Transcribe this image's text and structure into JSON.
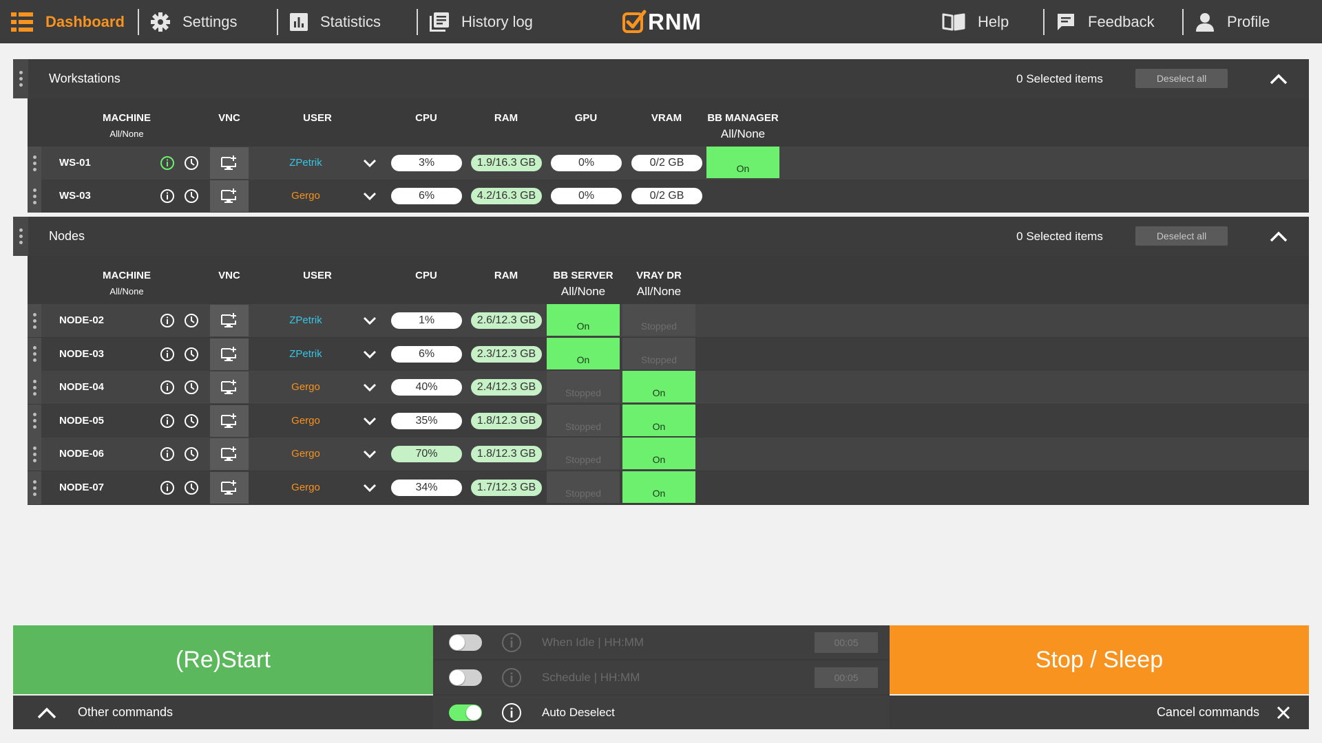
{
  "nav": {
    "dashboard": "Dashboard",
    "settings": "Settings",
    "statistics": "Statistics",
    "history": "History log",
    "logo": "RNM",
    "help": "Help",
    "feedback": "Feedback",
    "profile": "Profile"
  },
  "colors": {
    "accent": "#f7931e",
    "on_status": "#6df06d",
    "restart": "#5cb85c",
    "user_cyan": "#34c6e4",
    "user_orange": "#f7931e"
  },
  "workstations": {
    "title": "Workstations",
    "selected": "0 Selected items",
    "deselect": "Deselect all",
    "headers": {
      "machine": "MACHINE",
      "machine_sub": "All/None",
      "vnc": "VNC",
      "user": "USER",
      "cpu": "CPU",
      "ram": "RAM",
      "gpu": "GPU",
      "vram": "VRAM",
      "bb_manager": "BB MANAGER",
      "bb_manager_sub": "All/None"
    },
    "rows": [
      {
        "name": "WS-01",
        "user": "ZPetrik",
        "cpu": "3%",
        "ram": "1.9/16.3 GB",
        "gpu": "0%",
        "vram": "0/2 GB",
        "bb_manager": "On"
      },
      {
        "name": "WS-03",
        "user": "Gergo",
        "cpu": "6%",
        "ram": "4.2/16.3 GB",
        "gpu": "0%",
        "vram": "0/2 GB",
        "bb_manager": ""
      }
    ]
  },
  "nodes": {
    "title": "Nodes",
    "selected": "0 Selected items",
    "deselect": "Deselect all",
    "headers": {
      "machine": "MACHINE",
      "machine_sub": "All/None",
      "vnc": "VNC",
      "user": "USER",
      "cpu": "CPU",
      "ram": "RAM",
      "bb_server": "BB SERVER",
      "bb_server_sub": "All/None",
      "vray_dr": "VRAY DR",
      "vray_dr_sub": "All/None"
    },
    "rows": [
      {
        "name": "NODE-02",
        "user": "ZPetrik",
        "cpu": "1%",
        "ram": "2.6/12.3 GB",
        "bb_server": "On",
        "vray_dr": "Stopped"
      },
      {
        "name": "NODE-03",
        "user": "ZPetrik",
        "cpu": "6%",
        "ram": "2.3/12.3 GB",
        "bb_server": "On",
        "vray_dr": "Stopped"
      },
      {
        "name": "NODE-04",
        "user": "Gergo",
        "cpu": "40%",
        "ram": "2.4/12.3 GB",
        "bb_server": "Stopped",
        "vray_dr": "On"
      },
      {
        "name": "NODE-05",
        "user": "Gergo",
        "cpu": "35%",
        "ram": "1.8/12.3 GB",
        "bb_server": "Stopped",
        "vray_dr": "On"
      },
      {
        "name": "NODE-06",
        "user": "Gergo",
        "cpu": "70%",
        "ram": "1.8/12.3 GB",
        "bb_server": "Stopped",
        "vray_dr": "On"
      },
      {
        "name": "NODE-07",
        "user": "Gergo",
        "cpu": "34%",
        "ram": "1.7/12.3 GB",
        "bb_server": "Stopped",
        "vray_dr": "On"
      }
    ]
  },
  "commands": {
    "restart": "(Re)Start",
    "stop": "Stop / Sleep",
    "when_idle": "When Idle | HH:MM",
    "when_idle_time": "00:05",
    "schedule": "Schedule | HH:MM",
    "schedule_time": "00:05",
    "auto_deselect": "Auto Deselect",
    "other": "Other commands",
    "cancel": "Cancel commands"
  }
}
